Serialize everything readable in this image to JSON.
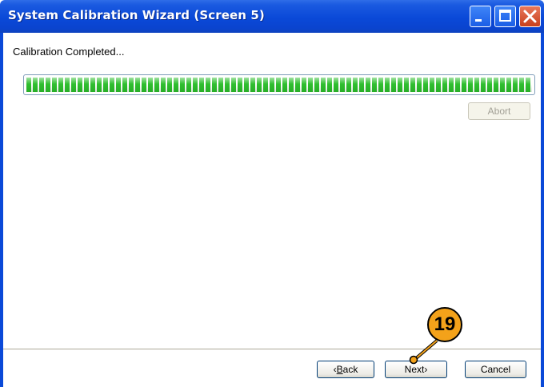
{
  "window": {
    "title": "System Calibration Wizard (Screen 5)"
  },
  "title_buttons": {
    "minimize": "minimize-icon",
    "maximize": "maximize-icon",
    "close": "close-icon"
  },
  "status": {
    "text": "Calibration Completed..."
  },
  "progress": {
    "value_percent": 100,
    "color": "#2fbf2f"
  },
  "buttons": {
    "abort": "Abort",
    "back_prefix": "‹",
    "back_mnemonic": "B",
    "back_rest": "ack",
    "next": "Next›",
    "cancel": "Cancel"
  },
  "callout": {
    "number": "19",
    "color": "#f3a21a"
  }
}
